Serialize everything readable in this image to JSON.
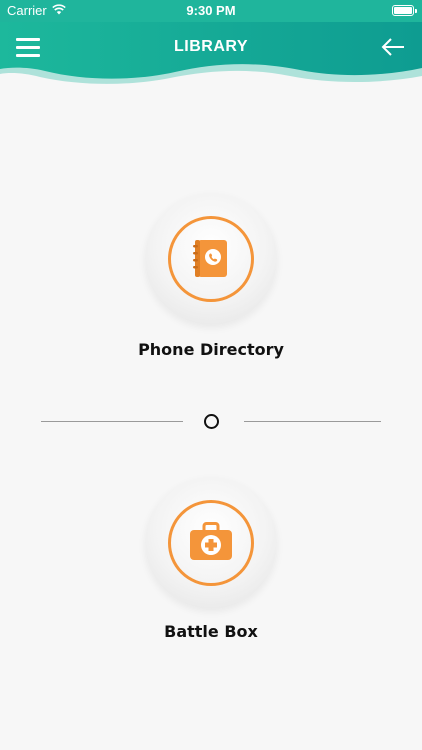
{
  "status_bar": {
    "carrier": "Carrier",
    "time": "9:30 PM",
    "icons": [
      "wifi-icon",
      "battery-icon"
    ]
  },
  "header": {
    "title": "LIBRARY",
    "menu_icon": "hamburger-menu-icon",
    "back_icon": "back-arrow-icon",
    "colors": {
      "primary": "#1fb59c",
      "secondary": "#0f9c90"
    }
  },
  "items": [
    {
      "label": "Phone Directory",
      "icon": "phone-book-icon",
      "accent": "#f4953a"
    },
    {
      "label": "Battle Box",
      "icon": "first-aid-kit-icon",
      "accent": "#f4953a"
    }
  ],
  "divider": {
    "icon": "circle-icon"
  }
}
